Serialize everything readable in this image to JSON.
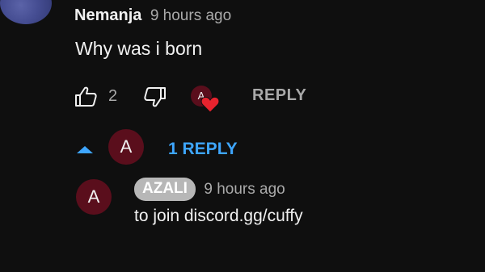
{
  "comment": {
    "author": "Nemanja",
    "timestamp": "9 hours ago",
    "text": "Why was i born",
    "like_count": "2",
    "reply_label": "REPLY",
    "creator_avatar_letter": "A",
    "heart_color": "#e8232e"
  },
  "replies_toggle": {
    "avatar_letter": "A",
    "label": "1 REPLY",
    "color": "#3ea6ff"
  },
  "reply": {
    "avatar_letter": "A",
    "author": "AZALI",
    "timestamp": "9 hours ago",
    "text": "to join discord.gg/cuffy"
  },
  "icons": {
    "like": "thumb-up-icon",
    "dislike": "thumb-down-icon",
    "heart": "heart-icon",
    "expand": "caret-up-icon"
  },
  "colors": {
    "background": "#0f0f0f",
    "avatar": "#5a0e1c",
    "badge": "#b7b7b7",
    "secondary_text": "#aaaaaa"
  }
}
